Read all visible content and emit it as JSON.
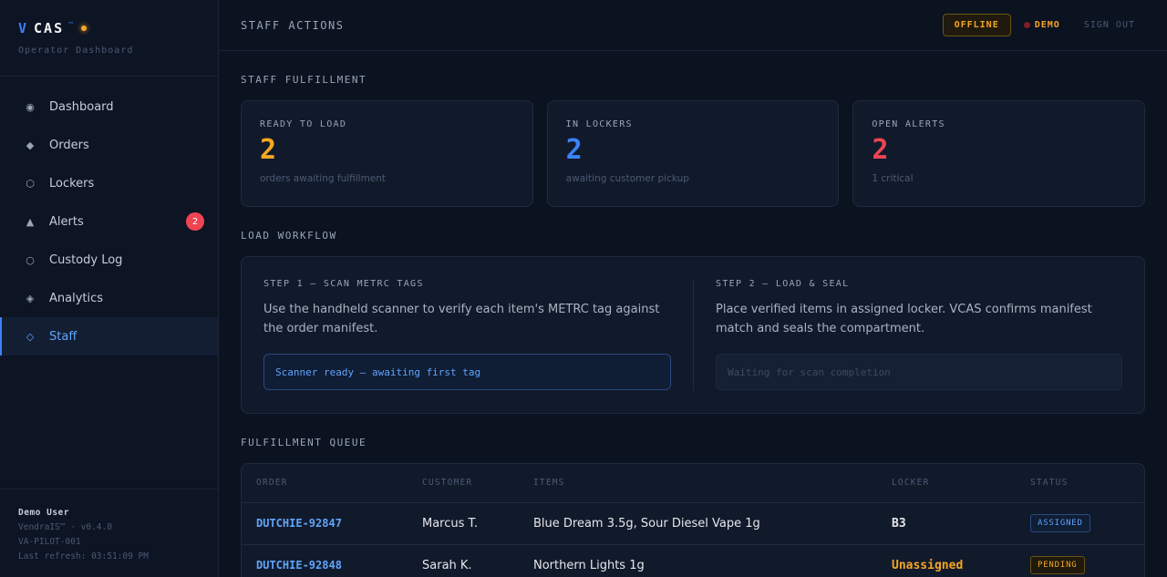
{
  "brand": {
    "v": "V",
    "name": "CAS",
    "tm": "™",
    "subtitle": "Operator Dashboard",
    "dot_color": "#f5a623"
  },
  "nav": {
    "items": [
      {
        "label": "Dashboard",
        "icon": "radio-dot-icon",
        "glyph": "◉"
      },
      {
        "label": "Orders",
        "icon": "diamond-filled-icon",
        "glyph": "◆"
      },
      {
        "label": "Lockers",
        "icon": "hexagon-icon",
        "glyph": "⬡"
      },
      {
        "label": "Alerts",
        "icon": "triangle-warning-icon",
        "glyph": "▲",
        "badge": "2"
      },
      {
        "label": "Custody Log",
        "icon": "circle-outline-icon",
        "glyph": "○"
      },
      {
        "label": "Analytics",
        "icon": "diamond-dot-icon",
        "glyph": "◈"
      },
      {
        "label": "Staff",
        "icon": "diamond-outline-icon",
        "glyph": "◇",
        "active": true
      }
    ]
  },
  "footer": {
    "user": "Demo User",
    "version": "VendraIS™ · v0.4.0",
    "pilot": "VA-PILOT-001",
    "refresh": "Last refresh: 03:51:09 PM"
  },
  "header": {
    "title": "STAFF ACTIONS",
    "offline": "OFFLINE",
    "demo": "DEMO",
    "signout": "SIGN OUT"
  },
  "fulfillment": {
    "label": "STAFF FULFILLMENT",
    "cards": [
      {
        "label": "READY TO LOAD",
        "value": "2",
        "sub": "orders awaiting fulfillment",
        "color": "#f5a623"
      },
      {
        "label": "IN LOCKERS",
        "value": "2",
        "sub": "awaiting customer pickup",
        "color": "#3b82f6"
      },
      {
        "label": "OPEN ALERTS",
        "value": "2",
        "sub": "1 critical",
        "color": "#ef4452"
      }
    ]
  },
  "workflow": {
    "label": "LOAD WORKFLOW",
    "step1": {
      "label": "STEP 1 — SCAN METRC TAGS",
      "desc": "Use the handheld scanner to verify each item's METRC tag against the order manifest.",
      "status": "Scanner ready — awaiting first tag"
    },
    "step2": {
      "label": "STEP 2 — LOAD & SEAL",
      "desc": "Place verified items in assigned locker. VCAS confirms manifest match and seals the compartment.",
      "status": "Waiting for scan completion"
    }
  },
  "queue": {
    "label": "FULFILLMENT QUEUE",
    "columns": [
      "ORDER",
      "CUSTOMER",
      "ITEMS",
      "LOCKER",
      "STATUS"
    ],
    "rows": [
      {
        "order": "DUTCHIE-92847",
        "customer": "Marcus T.",
        "items": "Blue Dream 3.5g, Sour Diesel Vape 1g",
        "locker": "B3",
        "status": "ASSIGNED"
      },
      {
        "order": "DUTCHIE-92848",
        "customer": "Sarah K.",
        "items": "Northern Lights 1g",
        "locker": "Unassigned",
        "status": "PENDING"
      }
    ]
  }
}
